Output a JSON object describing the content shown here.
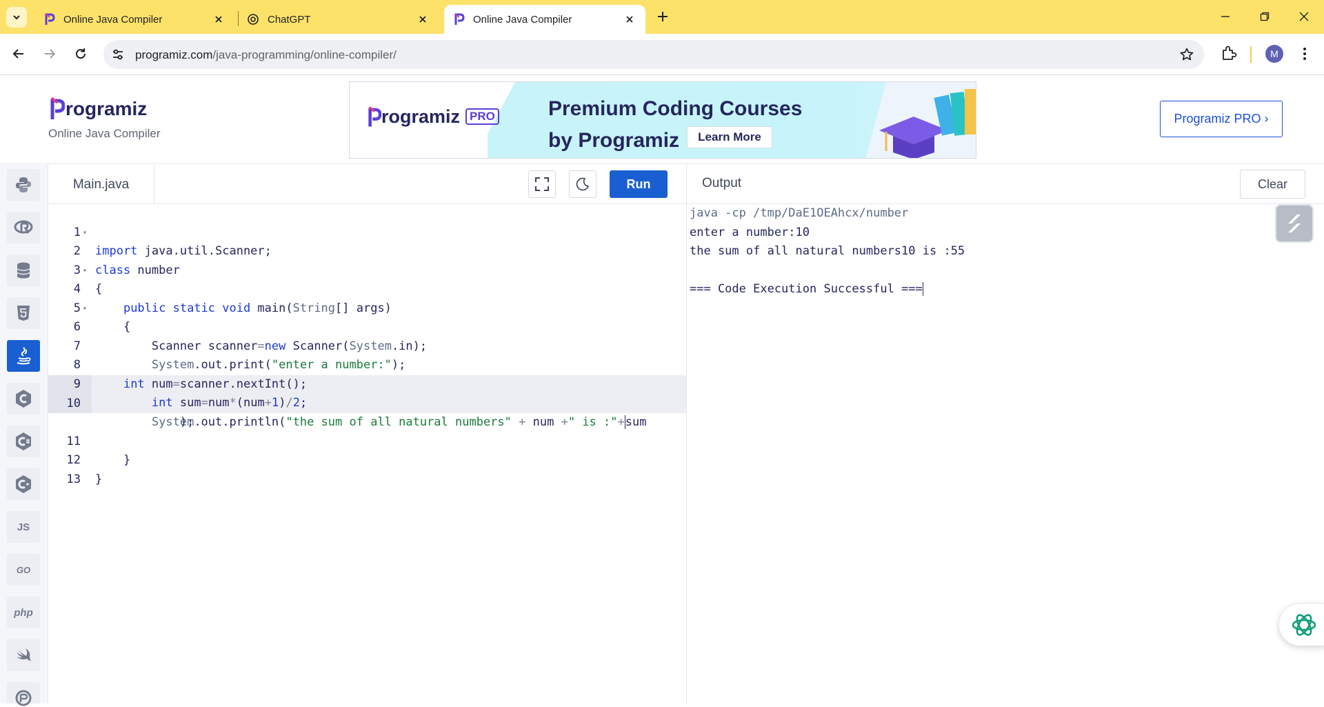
{
  "browser": {
    "tabs": [
      {
        "title": "Online Java Compiler",
        "active": false
      },
      {
        "title": "ChatGPT",
        "active": false
      },
      {
        "title": "Online Java Compiler",
        "active": true
      }
    ],
    "url_host": "programiz.com",
    "url_path": "/java-programming/online-compiler/",
    "profile_initial": "M"
  },
  "header": {
    "logo_text": "rogramiz",
    "subtitle": "Online Java Compiler",
    "banner": {
      "logo_text": "rogramiz",
      "pro_badge": "PRO",
      "headline_1": "Premium Coding Courses",
      "headline_2": "by Programiz",
      "cta": "Learn More"
    },
    "pro_button": "Programiz PRO ›"
  },
  "sidebar": {
    "items": [
      {
        "name": "python-icon"
      },
      {
        "name": "r-icon"
      },
      {
        "name": "sql-icon"
      },
      {
        "name": "html-icon"
      },
      {
        "name": "java-icon",
        "active": true
      },
      {
        "name": "c-icon"
      },
      {
        "name": "csharp-icon"
      },
      {
        "name": "cpp-icon"
      },
      {
        "name": "js-icon",
        "label": "JS"
      },
      {
        "name": "go-icon",
        "label": "GO"
      },
      {
        "name": "php-icon",
        "label": "php"
      },
      {
        "name": "swift-icon"
      },
      {
        "name": "rust-icon"
      }
    ]
  },
  "editor": {
    "filename": "Main.java",
    "run_label": "Run",
    "lines": [
      {
        "n": "1",
        "fold": true
      },
      {
        "n": "2"
      },
      {
        "n": "3",
        "fold": true
      },
      {
        "n": "4"
      },
      {
        "n": "5",
        "fold": true
      },
      {
        "n": "6"
      },
      {
        "n": "7"
      },
      {
        "n": "8"
      },
      {
        "n": "9"
      },
      {
        "n": "10"
      },
      {
        "n": "11"
      },
      {
        "n": "12"
      },
      {
        "n": "13"
      }
    ],
    "code": {
      "l1_kw": "import",
      "l1_rest": " java.util.Scanner;",
      "l2_kw": "class",
      "l2_rest": " number",
      "l3": "{",
      "l4_a": "public static void",
      "l4_b": " main(",
      "l4_c": "String",
      "l4_d": "[] args)",
      "l5": "{",
      "l6_a": "Scanner scanner",
      "l6_b": "=",
      "l6_c": "new",
      "l6_d": " Scanner(",
      "l6_e": "System",
      "l6_f": ".in);",
      "l7_a": "System",
      "l7_b": ".out.print(",
      "l7_c": "\"enter a number:\"",
      "l7_d": ");",
      "l8_a": "int",
      "l8_b": " num",
      "l8_c": "=",
      "l8_d": "scanner.nextInt();",
      "l9_a": "int",
      "l9_b": " sum",
      "l9_c": "=",
      "l9_d": "num",
      "l9_e": "*",
      "l9_f": "(num",
      "l9_g": "+",
      "l9_h": "1",
      "l9_i": ")",
      "l9_j": "/",
      "l9_k": "2",
      "l9_l": ";",
      "l10_a": "System",
      "l10_b": ".out.println(",
      "l10_c": "\"the sum of all natural numbers\"",
      "l10_d": " + ",
      "l10_e": "num ",
      "l10_f": "+",
      "l10_g": "\" is :\"",
      "l10_h": "+",
      "l10_i": "sum",
      "l10_wrap": ");",
      "l11": "}",
      "l12": "}"
    }
  },
  "output": {
    "label": "Output",
    "clear_label": "Clear",
    "lines": [
      "java -cp /tmp/DaE1OEAhcx/number",
      "enter a number:10",
      "the sum of all natural numbers10 is :55",
      "",
      "=== Code Execution Successful ==="
    ]
  }
}
